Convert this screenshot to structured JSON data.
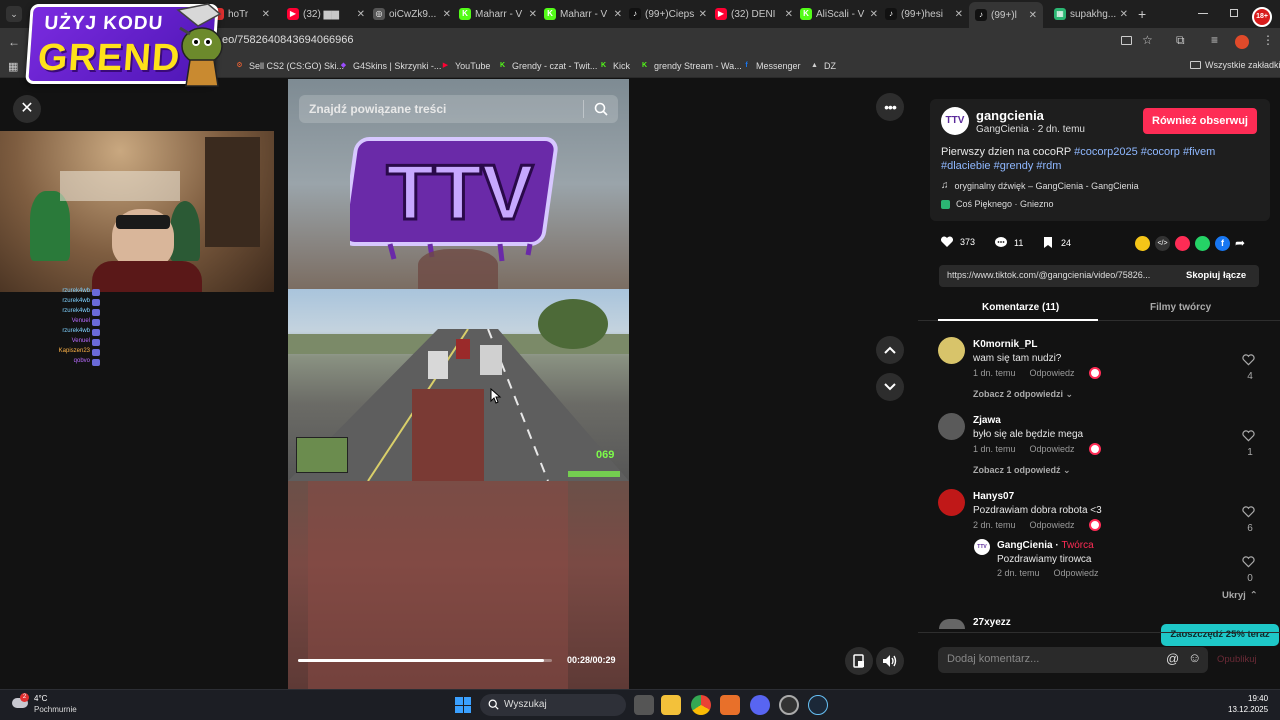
{
  "browser": {
    "tabs": [
      {
        "label": "hoTr",
        "color": "#e03030",
        "letter": ""
      },
      {
        "label": "(32) ▆▆",
        "color": "#ff0033",
        "letter": "▶"
      },
      {
        "label": "oiCwZk9...",
        "color": "#555555",
        "letter": "◎"
      },
      {
        "label": "Maharr - V",
        "color": "#53fc18",
        "letter": "K"
      },
      {
        "label": "Maharr - V",
        "color": "#53fc18",
        "letter": "K"
      },
      {
        "label": "(99+)Cieps",
        "color": "#111111",
        "letter": "♪"
      },
      {
        "label": "(32) DENI",
        "color": "#ff0033",
        "letter": "▶"
      },
      {
        "label": "AliScali - V",
        "color": "#53fc18",
        "letter": "K"
      },
      {
        "label": "(99+)hesi",
        "color": "#111111",
        "letter": "♪"
      },
      {
        "label": "(99+)l",
        "color": "#111111",
        "letter": "♪"
      },
      {
        "label": "supakhg...",
        "color": "#2bb673",
        "letter": "▦"
      }
    ],
    "new_tab": "+",
    "url": "eo/7582640843694066966",
    "bookmarks": [
      {
        "label": "Sell CS2 (CS:GO) Ski...",
        "color": "#ff6633",
        "letter": "⚙"
      },
      {
        "label": "G4Skins | Skrzynki -...",
        "color": "#9b4dff",
        "letter": "◆"
      },
      {
        "label": "YouTube",
        "color": "#ff0033",
        "letter": "▶"
      },
      {
        "label": "Grendy - czat - Twit...",
        "color": "#53fc18",
        "letter": "K"
      },
      {
        "label": "Kick",
        "color": "#53fc18",
        "letter": "K"
      },
      {
        "label": "grendy Stream - Wa...",
        "color": "#53fc18",
        "letter": "K"
      },
      {
        "label": "Messenger",
        "color": "#1877f2",
        "letter": "f"
      },
      {
        "label": "DZ",
        "color": "#d0d0d0",
        "letter": "▲"
      }
    ],
    "all_bookmarks": "Wszystkie zakładki",
    "age_badge": "18+"
  },
  "promo": {
    "line1": "UŻYJ KODU",
    "line2": "GRENDY"
  },
  "chat": [
    {
      "user": "rzurek4wb",
      "color": "#7fd1ff"
    },
    {
      "user": "rzurek4wb",
      "color": "#7fd1ff"
    },
    {
      "user": "rzurek4wb",
      "color": "#7fd1ff"
    },
    {
      "user": "Venuel",
      "color": "#b86bff"
    },
    {
      "user": "rzurek4wb",
      "color": "#7fd1ff"
    },
    {
      "user": "Venuel",
      "color": "#b86bff"
    },
    {
      "user": "Kapiszen23",
      "color": "#ffb347"
    },
    {
      "user": "qobvo",
      "color": "#b86bff"
    }
  ],
  "video": {
    "search_placeholder": "Znajdź powiązane treści",
    "logo_text": "TTV",
    "time": "00:28/00:29",
    "progress": 0.97,
    "hud_speed": "069"
  },
  "post": {
    "display_name": "gangcienia",
    "handle": "GangCienia",
    "age": "2 dn. temu",
    "follow_label": "Również obserwuj",
    "caption": "Pierwszy dzien na cocoRP",
    "hashtags_line1": "#cocorp2025 #cocorp #fivem",
    "hashtags_line2": "#dlaciebie #grendy #rdm",
    "sound": "oryginalny dźwięk – GangCienia - GangCienia",
    "location": "Coś Pięknego · Gniezno",
    "likes": "373",
    "comments": "11",
    "saves": "24",
    "share_url": "https://www.tiktok.com/@gangcienia/video/75826...",
    "copy_label": "Skopiuj łącze",
    "tab_comments": "Komentarze (11)",
    "tab_creator": "Filmy twórcy",
    "accent": "#fe2c55"
  },
  "comments": [
    {
      "user": "K0mornik_PL",
      "text": "wam się tam nudzi?",
      "age": "1 dn. temu",
      "reply": "Odpowiedz",
      "likes": "4",
      "more": "Zobacz 2 odpowiedzi",
      "avatar": "#d8c46a"
    },
    {
      "user": "Zjawa",
      "text": "było się ale będzie mega",
      "age": "1 dn. temu",
      "reply": "Odpowiedz",
      "likes": "1",
      "more": "Zobacz 1 odpowiedź",
      "avatar": "#5a5a5a"
    },
    {
      "user": "Hanys07",
      "text": "Pozdrawiam dobra robota <3",
      "age": "2 dn. temu",
      "reply": "Odpowiedz",
      "likes": "6",
      "more": "",
      "avatar": "#c01818"
    }
  ],
  "creator_reply": {
    "user": "GangCienia",
    "badge": "Twórca",
    "text": "Pozdrawiamy tirowca",
    "age": "2 dn. temu",
    "reply": "Odpowiedz",
    "likes": "0",
    "hide": "Ukryj"
  },
  "next_comment_user": "27xyezz",
  "promo_toast": "Zaoszczędź 25% teraz",
  "comment_input": {
    "placeholder": "Dodaj komentarz...",
    "post_label": "Opublikuj"
  },
  "taskbar": {
    "weather_temp": "4°C",
    "weather_desc": "Pochmurnie",
    "weather_badge": "2",
    "search_placeholder": "Wyszukaj",
    "time": "19:40",
    "date": "13.12.2025"
  }
}
